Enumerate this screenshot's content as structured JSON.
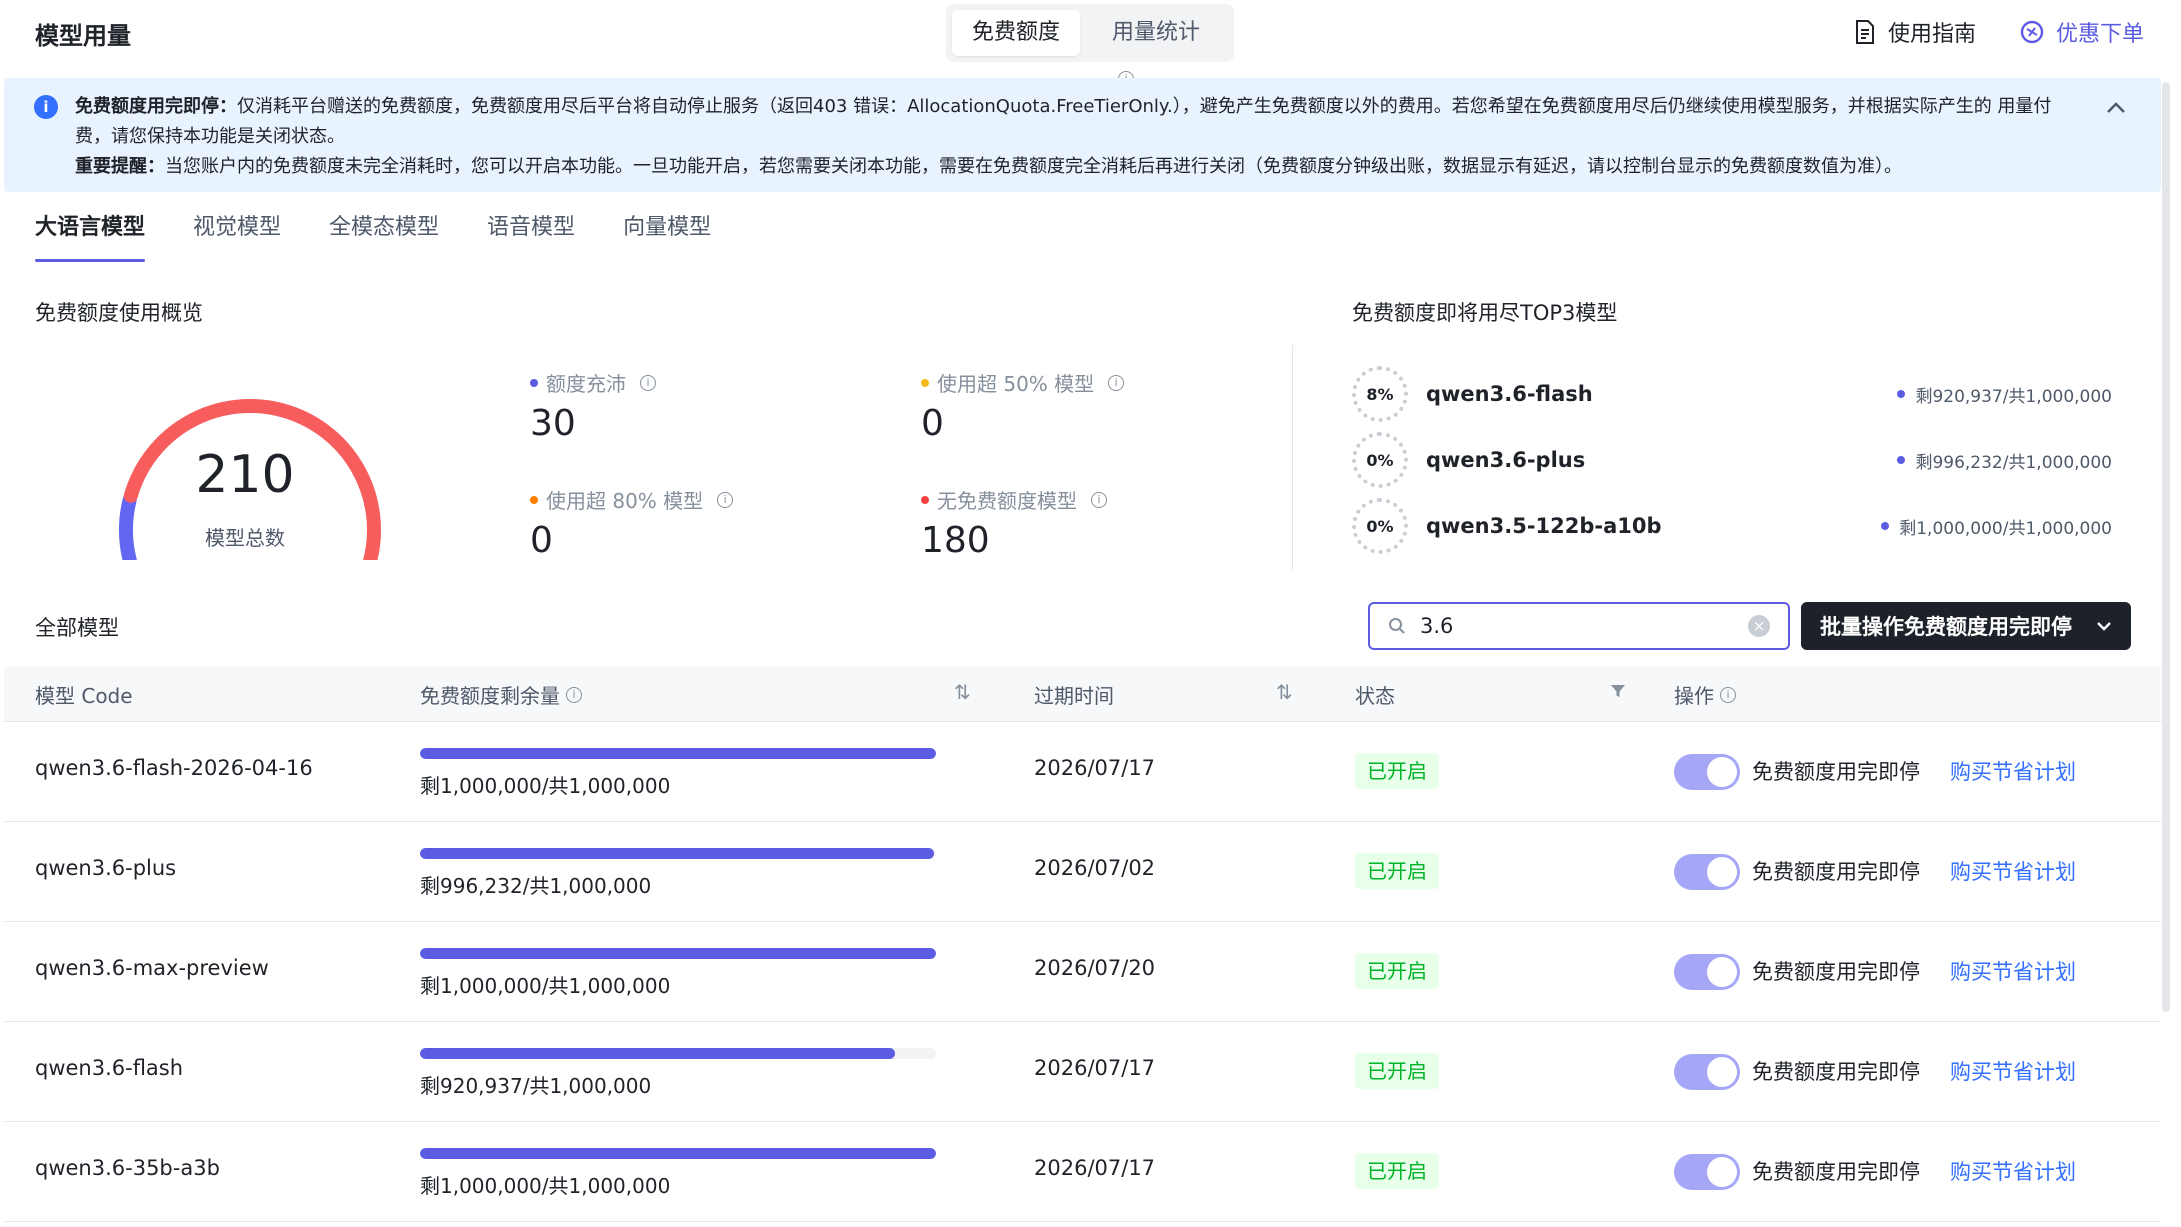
{
  "header": {
    "title": "模型用量",
    "segments": [
      {
        "label": "免费额度"
      },
      {
        "label": "用量统计"
      }
    ],
    "guide_label": "使用指南",
    "promo_label": "优惠下单"
  },
  "alert": {
    "bold1": "免费额度用完即停：",
    "text1": "仅消耗平台赠送的免费额度，免费额度用尽后平台将自动停止服务（返回403 错误：AllocationQuota.FreeTierOnly.），避免产生免费额度以外的费用。若您希望在免费额度用尽后仍继续使用模型服务，并根据实际产生的 用量付费，请您保持本功能是关闭状态。",
    "bold2": "重要提醒：",
    "text2": "当您账户内的免费额度未完全消耗时，您可以开启本功能。一旦功能开启，若您需要关闭本功能，需要在免费额度完全消耗后再进行关闭（免费额度分钟级出账，数据显示有延迟，请以控制台显示的免费额度数值为准）。"
  },
  "tabs": [
    {
      "label": "大语言模型"
    },
    {
      "label": "视觉模型"
    },
    {
      "label": "全模态模型"
    },
    {
      "label": "语音模型"
    },
    {
      "label": "向量模型"
    }
  ],
  "overview": {
    "title": "免费额度使用概览",
    "total_value": "210",
    "total_label": "模型总数",
    "stats": [
      {
        "label": "额度充沛",
        "value": "30",
        "color": "#5b5ce2"
      },
      {
        "label": "使用超 50% 模型",
        "value": "0",
        "color": "#f7ba1e"
      },
      {
        "label": "使用超 80% 模型",
        "value": "0",
        "color": "#ff7d00"
      },
      {
        "label": "无免费额度模型",
        "value": "180",
        "color": "#f53f3f"
      }
    ],
    "gauge": {
      "total": 210,
      "segments": [
        {
          "value": 30,
          "color": "#6366f1"
        },
        {
          "value": 180,
          "color": "#f85d5d"
        }
      ]
    }
  },
  "top3": {
    "title": "免费额度即将用尽TOP3模型",
    "items": [
      {
        "pct": "8%",
        "name": "qwen3.6-flash",
        "remaining": "剩920,937/共1,000,000"
      },
      {
        "pct": "0%",
        "name": "qwen3.6-plus",
        "remaining": "剩996,232/共1,000,000"
      },
      {
        "pct": "0%",
        "name": "qwen3.5-122b-a10b",
        "remaining": "剩1,000,000/共1,000,000"
      }
    ]
  },
  "models": {
    "title": "全部模型",
    "search_value": "3.6",
    "bulk_label": "批量操作免费额度用完即停",
    "columns": {
      "code": "模型 Code",
      "remaining": "免费额度剩余量",
      "expire": "过期时间",
      "status": "状态",
      "action": "操作"
    },
    "rows": [
      {
        "code": "qwen3.6-flash-2026-04-16",
        "fraction": 1.0,
        "remaining": "剩1,000,000/共1,000,000",
        "expire": "2026/07/17",
        "status": "已开启",
        "toggle_label": "免费额度用完即停",
        "plan_label": "购买节省计划"
      },
      {
        "code": "qwen3.6-plus",
        "fraction": 0.996,
        "remaining": "剩996,232/共1,000,000",
        "expire": "2026/07/02",
        "status": "已开启",
        "toggle_label": "免费额度用完即停",
        "plan_label": "购买节省计划"
      },
      {
        "code": "qwen3.6-max-preview",
        "fraction": 1.0,
        "remaining": "剩1,000,000/共1,000,000",
        "expire": "2026/07/20",
        "status": "已开启",
        "toggle_label": "免费额度用完即停",
        "plan_label": "购买节省计划"
      },
      {
        "code": "qwen3.6-flash",
        "fraction": 0.921,
        "remaining": "剩920,937/共1,000,000",
        "expire": "2026/07/17",
        "status": "已开启",
        "toggle_label": "免费额度用完即停",
        "plan_label": "购买节省计划"
      },
      {
        "code": "qwen3.6-35b-a3b",
        "fraction": 1.0,
        "remaining": "剩1,000,000/共1,000,000",
        "expire": "2026/07/17",
        "status": "已开启",
        "toggle_label": "免费额度用完即停",
        "plan_label": "购买节省计划"
      }
    ]
  }
}
